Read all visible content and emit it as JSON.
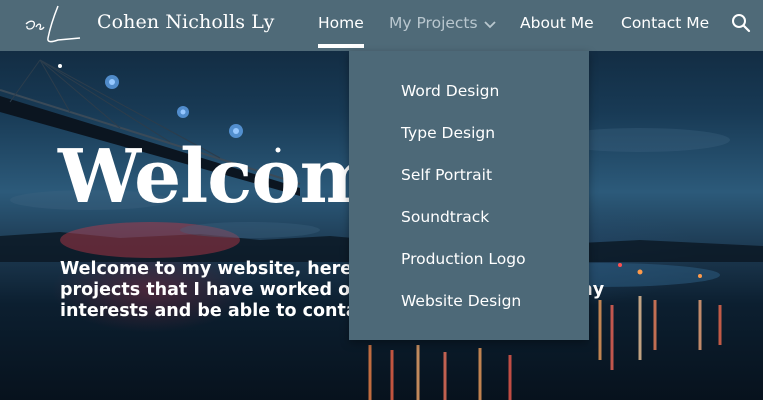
{
  "navbar": {
    "site_title": "Cohen Nicholls Ly",
    "logo_icon": "signature-logo-icon",
    "items": [
      {
        "label": "Home",
        "active": true
      },
      {
        "label": "My Projects",
        "expanded": true
      },
      {
        "label": "About Me"
      },
      {
        "label": "Contact Me"
      }
    ],
    "search_icon": "search-icon"
  },
  "dropdown": {
    "items": [
      {
        "label": "Word Design"
      },
      {
        "label": "Type Design"
      },
      {
        "label": "Self Portrait"
      },
      {
        "label": "Soundtrack"
      },
      {
        "label": "Production Logo"
      },
      {
        "label": "Website Design"
      }
    ]
  },
  "hero": {
    "heading": "Welcome",
    "lines": [
      "Welcome to my website, here you can see the",
      "projects that I have worked on and about me, learn my",
      "interests and be able to contact me."
    ]
  },
  "colors": {
    "navbar_bg": "#4f6a78",
    "dropdown_bg": "#4d6978",
    "inactive_nav": "#b9c7cf"
  }
}
